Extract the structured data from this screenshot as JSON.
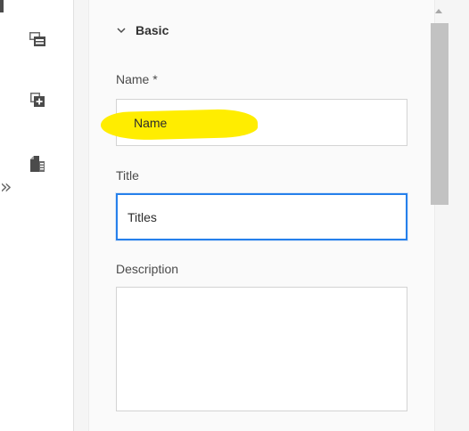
{
  "rail": {
    "expand_glyph": "»",
    "icons": [
      "layout-panels-icon",
      "add-component-icon",
      "document-properties-icon"
    ]
  },
  "panel": {
    "section": {
      "title": "Basic",
      "chevron_icon": "chevron-down-icon"
    },
    "fields": {
      "name": {
        "label": "Name *",
        "value": "Name"
      },
      "title": {
        "label": "Title",
        "value": "Titles"
      },
      "description": {
        "label": "Description",
        "value": ""
      }
    }
  },
  "colors": {
    "highlight": "#ffed00",
    "focus_border": "#2680eb",
    "panel_bg": "#f5f5f5",
    "scroll_thumb": "#c2c2c2"
  }
}
